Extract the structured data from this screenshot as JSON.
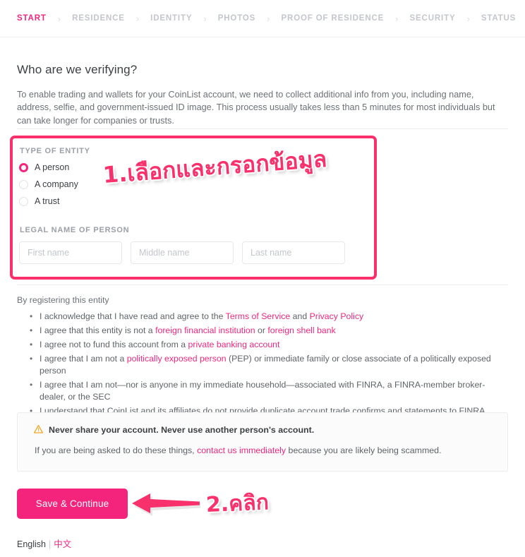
{
  "breadcrumb": {
    "separator": "›",
    "items": [
      {
        "label": "START",
        "active": true
      },
      {
        "label": "RESIDENCE",
        "active": false
      },
      {
        "label": "IDENTITY",
        "active": false
      },
      {
        "label": "PHOTOS",
        "active": false
      },
      {
        "label": "PROOF OF RESIDENCE",
        "active": false
      },
      {
        "label": "SECURITY",
        "active": false
      },
      {
        "label": "STATUS",
        "active": false
      }
    ]
  },
  "main": {
    "heading": "Who are we verifying?",
    "intro": "To enable trading and wallets for your CoinList account, we need to collect additional info from you, including name, address, selfie, and government-issued ID image. This process usually takes less than 5 minutes for most individuals but can take longer for companies or trusts."
  },
  "form": {
    "entity_label": "TYPE OF ENTITY",
    "options": [
      {
        "label": "A person",
        "selected": true
      },
      {
        "label": "A company",
        "selected": false
      },
      {
        "label": "A trust",
        "selected": false
      }
    ],
    "legal_name_label": "LEGAL NAME OF PERSON",
    "fields": [
      {
        "name": "first",
        "placeholder": "First name",
        "value": ""
      },
      {
        "name": "middle",
        "placeholder": "Middle name",
        "value": ""
      },
      {
        "name": "last",
        "placeholder": "Last name",
        "value": ""
      }
    ]
  },
  "annotations": {
    "step1": "1.เลือกและกรอกข้อมูล",
    "step2": "2.คลิก",
    "arrow": "left-arrow",
    "color": "#f8316d"
  },
  "agreement": {
    "heading": "By registering this entity",
    "items": [
      {
        "parts": [
          {
            "t": "I acknowledge that I have read and agree to the ",
            "link": false
          },
          {
            "t": "Terms of Service",
            "link": true
          },
          {
            "t": " and ",
            "link": false
          },
          {
            "t": "Privacy Policy",
            "link": true
          }
        ]
      },
      {
        "parts": [
          {
            "t": "I agree that this entity is not a ",
            "link": false
          },
          {
            "t": "foreign financial institution",
            "link": true
          },
          {
            "t": " or ",
            "link": false
          },
          {
            "t": "foreign shell bank",
            "link": true
          }
        ]
      },
      {
        "parts": [
          {
            "t": "I agree not to fund this account from a ",
            "link": false
          },
          {
            "t": "private banking account",
            "link": true
          }
        ]
      },
      {
        "parts": [
          {
            "t": "I agree that I am not a ",
            "link": false
          },
          {
            "t": "politically exposed person",
            "link": true
          },
          {
            "t": " (PEP) or immediate family or close associate of a politically exposed person",
            "link": false
          }
        ]
      },
      {
        "parts": [
          {
            "t": "I agree that I am not—nor is anyone in my immediate household—associated with FINRA, a FINRA-member broker-dealer, or the SEC",
            "link": false
          }
        ]
      },
      {
        "parts": [
          {
            "t": "I understand that CoinList and its affiliates do not provide duplicate account trade confirms and statements to FINRA",
            "link": false
          }
        ]
      }
    ]
  },
  "warning": {
    "icon": "warning-triangle-icon",
    "icon_color": "#f5a623",
    "title": "Never share your account. Never use another person's account.",
    "body_before": "If you are being asked to do these things, ",
    "body_link": "contact us immediately",
    "body_after": " because you are likely being scammed."
  },
  "submit": {
    "label": "Save & Continue",
    "color": "#f4247c"
  },
  "language": {
    "current": "English",
    "separator": "|",
    "alternate": "中文"
  }
}
